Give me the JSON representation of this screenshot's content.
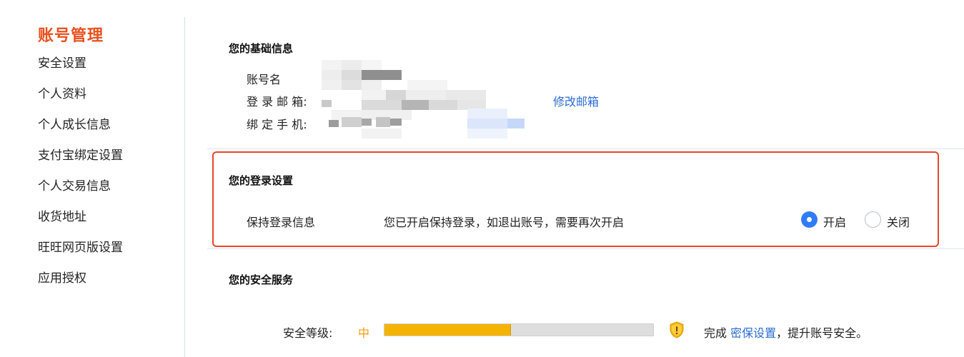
{
  "sidebar": {
    "title": "账号管理",
    "items": [
      {
        "label": "安全设置"
      },
      {
        "label": "个人资料"
      },
      {
        "label": "个人成长信息"
      },
      {
        "label": "支付宝绑定设置"
      },
      {
        "label": "个人交易信息"
      },
      {
        "label": "收货地址"
      },
      {
        "label": "旺旺网页版设置"
      },
      {
        "label": "应用授权"
      }
    ]
  },
  "basic_info": {
    "title": "您的基础信息",
    "account_name_label": "账号名",
    "email_label": "登 录 邮 箱:",
    "phone_label": "绑 定 手 机:",
    "change_email_link": "修改邮箱"
  },
  "login_settings": {
    "title": "您的登录设置",
    "keep_login_label": "保持登录信息",
    "keep_login_desc": "您已开启保持登录，如退出账号，需要再次开启",
    "option_on": "开启",
    "option_off": "关闭",
    "selected": "开启",
    "highlight_color": "#e8452c"
  },
  "security_service": {
    "title": "您的安全服务",
    "level_label": "安全等级:",
    "level_value": "中",
    "level_fraction": 0.47,
    "tip_prefix": "完成",
    "tip_link": "密保设置",
    "tip_suffix": "，提升账号安全。",
    "shield_icon": "shield-warning-icon",
    "level_color": "#f39c12"
  },
  "colors": {
    "accent": "#e8501d",
    "link": "#2a6cd2",
    "radio_on": "#2f7cf6",
    "bar_fill": "#f5b400"
  }
}
